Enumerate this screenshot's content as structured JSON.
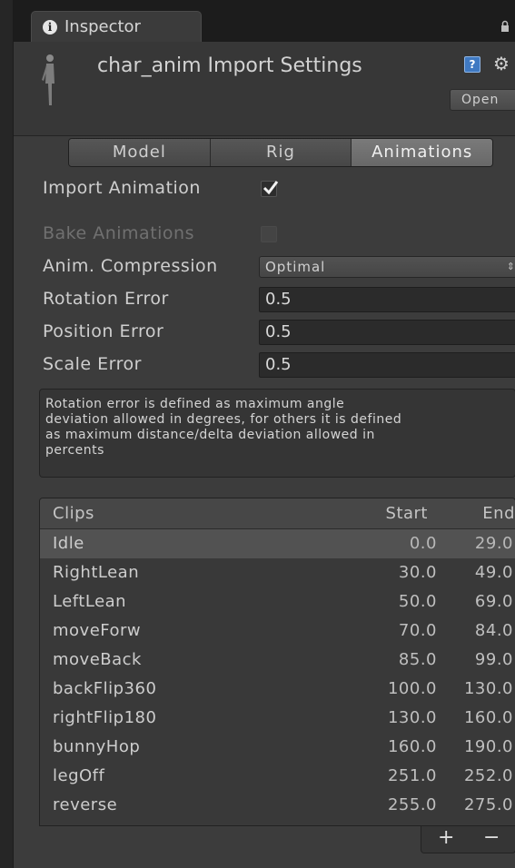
{
  "tab": {
    "label": "Inspector"
  },
  "header": {
    "title": "char_anim Import Settings",
    "help_icon_glyph": "?",
    "open_label": "Open"
  },
  "tabs": {
    "items": [
      "Model",
      "Rig",
      "Animations"
    ],
    "active": "Animations"
  },
  "settings": {
    "import_animation": {
      "label": "Import Animation",
      "checked": true
    },
    "bake_animations": {
      "label": "Bake Animations",
      "checked": false,
      "disabled": true
    },
    "anim_compression": {
      "label": "Anim. Compression",
      "value": "Optimal"
    },
    "rotation_error": {
      "label": "Rotation Error",
      "value": "0.5"
    },
    "position_error": {
      "label": "Position Error",
      "value": "0.5"
    },
    "scale_error": {
      "label": "Scale Error",
      "value": "0.5"
    }
  },
  "help_lines": [
    "Rotation error is defined as maximum angle",
    "deviation allowed in degrees, for others it is defined",
    "as maximum distance/delta deviation allowed in",
    "percents"
  ],
  "clips": {
    "headers": {
      "name": "Clips",
      "start": "Start",
      "end": "End"
    },
    "rows": [
      {
        "name": "Idle",
        "start": "0.0",
        "end": "29.0",
        "selected": true
      },
      {
        "name": "RightLean",
        "start": "30.0",
        "end": "49.0"
      },
      {
        "name": "LeftLean",
        "start": "50.0",
        "end": "69.0"
      },
      {
        "name": "moveForw",
        "start": "70.0",
        "end": "84.0"
      },
      {
        "name": "moveBack",
        "start": "85.0",
        "end": "99.0"
      },
      {
        "name": "backFlip360",
        "start": "100.0",
        "end": "130.0"
      },
      {
        "name": "rightFlip180",
        "start": "130.0",
        "end": "160.0"
      },
      {
        "name": "bunnyHop",
        "start": "160.0",
        "end": "190.0"
      },
      {
        "name": "legOff",
        "start": "251.0",
        "end": "252.0"
      },
      {
        "name": "reverse",
        "start": "255.0",
        "end": "275.0"
      }
    ],
    "add_label": "+",
    "remove_label": "−"
  },
  "colors": {
    "panel": "#3c3c3c",
    "selected_row": "#525252",
    "active_tab": "#6e6e6e",
    "help_icon": "#3f79c2"
  }
}
